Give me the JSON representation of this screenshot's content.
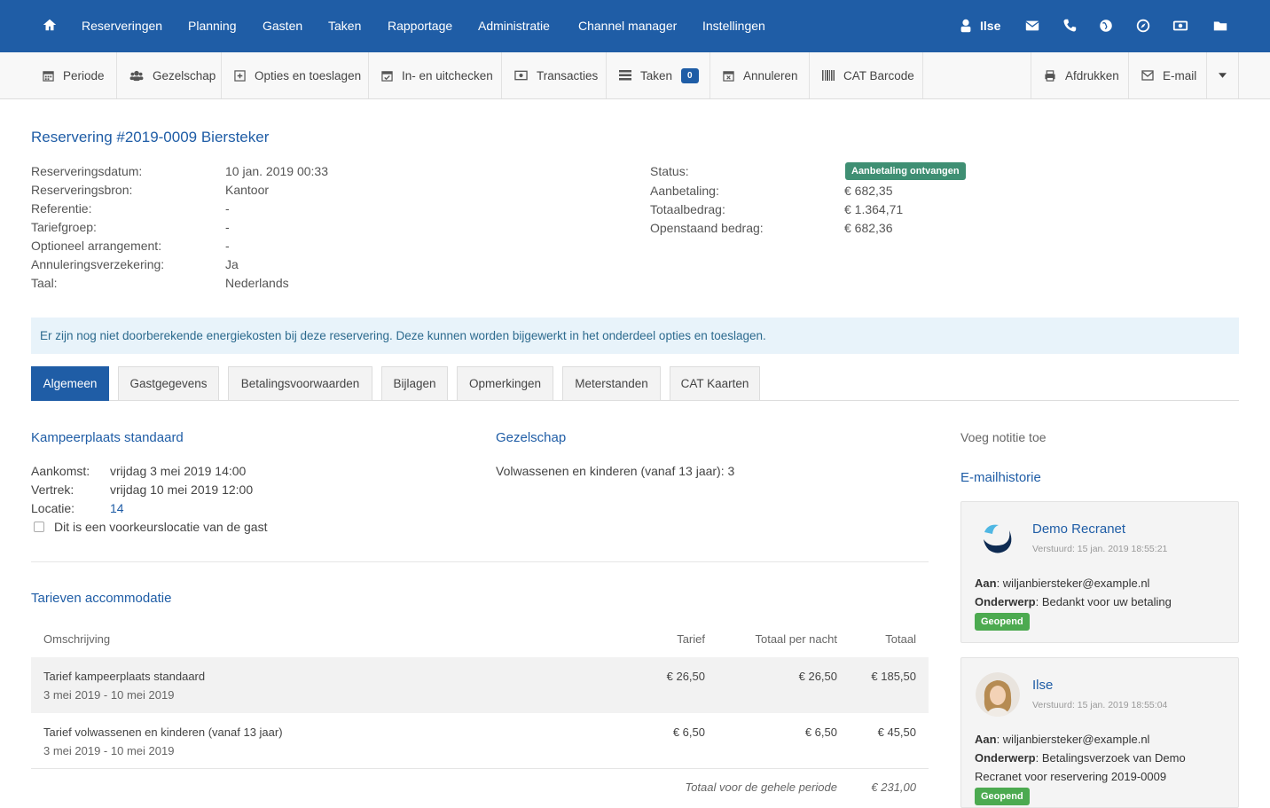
{
  "topnav": {
    "items": [
      "Reserveringen",
      "Planning",
      "Gasten",
      "Taken",
      "Rapportage",
      "Administratie",
      "Channel manager",
      "Instellingen"
    ],
    "user": "Ilse",
    "icons": [
      "home-icon",
      "user-icon",
      "envelope-icon",
      "phone-icon",
      "globe-icon",
      "compass-icon",
      "money-icon",
      "folder-icon"
    ]
  },
  "toolbar": {
    "periode": "Periode",
    "gezelschap": "Gezelschap",
    "opties": "Opties en toeslagen",
    "checkin": "In- en uitchecken",
    "transacties": "Transacties",
    "taken": "Taken",
    "taken_count": "0",
    "annuleren": "Annuleren",
    "barcode": "CAT Barcode",
    "afdrukken": "Afdrukken",
    "email": "E-mail"
  },
  "reservation": {
    "title": "Reservering #2019-0009 Biersteker",
    "left": [
      {
        "label": "Reserveringsdatum:",
        "value": "10 jan. 2019 00:33"
      },
      {
        "label": "Reserveringsbron:",
        "value": "Kantoor"
      },
      {
        "label": "Referentie:",
        "value": "-"
      },
      {
        "label": "Tariefgroep:",
        "value": "-"
      },
      {
        "label": "Optioneel arrangement:",
        "value": "-"
      },
      {
        "label": "Annuleringsverzekering:",
        "value": "Ja"
      },
      {
        "label": "Taal:",
        "value": "Nederlands"
      }
    ],
    "right": [
      {
        "label": "Status:",
        "value": ""
      },
      {
        "label": "Aanbetaling:",
        "value": "€ 682,35"
      },
      {
        "label": "Totaalbedrag:",
        "value": "€ 1.364,71"
      },
      {
        "label": "Openstaand bedrag:",
        "value": "€ 682,36"
      }
    ],
    "status_badge": "Aanbetaling ontvangen",
    "status_color": "#3f8f73"
  },
  "alert": "Er zijn nog niet doorberekende energiekosten bij deze reservering. Deze kunnen worden bijgewerkt in het onderdeel opties en toeslagen.",
  "tabs": [
    "Algemeen",
    "Gastgegevens",
    "Betalingsvoorwaarden",
    "Bijlagen",
    "Opmerkingen",
    "Meterstanden",
    "CAT Kaarten"
  ],
  "accommodation": {
    "title": "Kampeerplaats standaard",
    "aankomst_label": "Aankomst:",
    "aankomst": "vrijdag 3 mei 2019 14:00",
    "vertrek_label": "Vertrek:",
    "vertrek": "vrijdag 10 mei 2019 12:00",
    "locatie_label": "Locatie:",
    "locatie": "14",
    "voorkeur": "Dit is een voorkeurslocatie van de gast"
  },
  "gezelschap": {
    "title": "Gezelschap",
    "line": "Volwassenen en kinderen (vanaf 13 jaar): 3"
  },
  "tarieven": {
    "title": "Tarieven accommodatie",
    "headers": [
      "Omschrijving",
      "Tarief",
      "Totaal per nacht",
      "Totaal"
    ],
    "rows": [
      {
        "desc": "Tarief kampeerplaats standaard",
        "period": "3 mei 2019 - 10 mei 2019",
        "tarief": "€ 26,50",
        "pernacht": "€ 26,50",
        "totaal": "€ 185,50"
      },
      {
        "desc": "Tarief volwassenen en kinderen (vanaf 13 jaar)",
        "period": "3 mei 2019 - 10 mei 2019",
        "tarief": "€ 6,50",
        "pernacht": "€ 6,50",
        "totaal": "€ 45,50"
      }
    ],
    "total_label": "Totaal voor de gehele periode",
    "total": "€ 231,00"
  },
  "sidebar": {
    "add_note": "Voeg notitie toe",
    "history_title": "E-mailhistorie",
    "emails": [
      {
        "sender": "Demo Recranet",
        "sent": "Verstuurd: 15 jan. 2019 18:55:21",
        "to_label": "Aan",
        "to": ": wiljanbiersteker@example.nl",
        "subject_label": "Onderwerp",
        "subject": ": Bedankt voor uw betaling",
        "subject2": "",
        "badge": "Geopend"
      },
      {
        "sender": "Ilse",
        "sent": "Verstuurd: 15 jan. 2019 18:55:04",
        "to_label": "Aan",
        "to": ": wiljanbiersteker@example.nl",
        "subject_label": "Onderwerp",
        "subject": ": Betalingsverzoek van Demo",
        "subject2": "Recranet voor reservering 2019-0009",
        "badge": "Geopend"
      }
    ]
  }
}
